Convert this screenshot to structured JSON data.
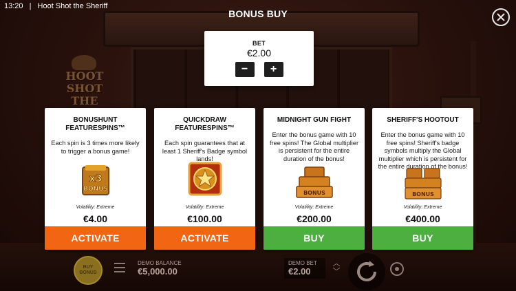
{
  "status_bar": {
    "time": "13:20",
    "separator": "|",
    "app_title": "Hoot Shot the Sheriff"
  },
  "dialog": {
    "title": "BONUS BUY"
  },
  "bet_panel": {
    "label": "BET",
    "value": "€2.00",
    "decrease_label": "−",
    "increase_label": "+"
  },
  "background": {
    "logo_line1": "HOOT SHOT",
    "logo_line2": "THE SHERIFF"
  },
  "cards": [
    {
      "title": "BONUSHUNT FEATURESPINS™",
      "description": "Each spin is 3 times more likely to trigger a bonus game!",
      "art_icon": "x3-bonus-icon",
      "art_text_top": "x3",
      "art_text_bottom": "BONUS",
      "volatility": "Volatility: Extreme",
      "price": "€4.00",
      "action": "ACTIVATE",
      "action_color": "#f26512"
    },
    {
      "title": "QUICKDRAW FEATURESPINS™",
      "description": "Each spin guarantees that at least 1 Sheriff's Badge symbol lands!",
      "art_icon": "sheriff-badge-icon",
      "volatility": "Volatility: Extreme",
      "price": "€100.00",
      "action": "ACTIVATE",
      "action_color": "#f26512"
    },
    {
      "title": "MIDNIGHT GUN FIGHT",
      "description": "Enter the bonus game with 10 free spins! The Global multiplier is persistent for the entire duration of the bonus!",
      "art_icon": "bonus-stack-icon",
      "art_text": "BONUS",
      "volatility": "Volatility: Extreme",
      "price": "€200.00",
      "action": "BUY",
      "action_color": "#4caf3f"
    },
    {
      "title": "SHERIFF'S HOOTOUT",
      "description": "Enter the bonus game with 10 free spins! Sheriff's badge symbols multiply the Global multiplier which is persistent for the entire duration of the bonus!",
      "art_icon": "bonus-stack-double-icon",
      "art_text": "BONUS",
      "volatility": "Volatility: Extreme",
      "price": "€400.00",
      "action": "BUY",
      "action_color": "#4caf3f"
    }
  ],
  "bottom_bar": {
    "buy_bonus_label": "BUY BONUS",
    "demo_balance_label": "DEMO BALANCE",
    "demo_balance_value": "€5,000.00",
    "demo_bet_label": "DEMO BET",
    "demo_bet_value": "€2.00"
  },
  "colors": {
    "orange": "#f26512",
    "green": "#4caf3f",
    "card_bg": "#ffffff",
    "dark_btn": "#1f1f1f"
  }
}
